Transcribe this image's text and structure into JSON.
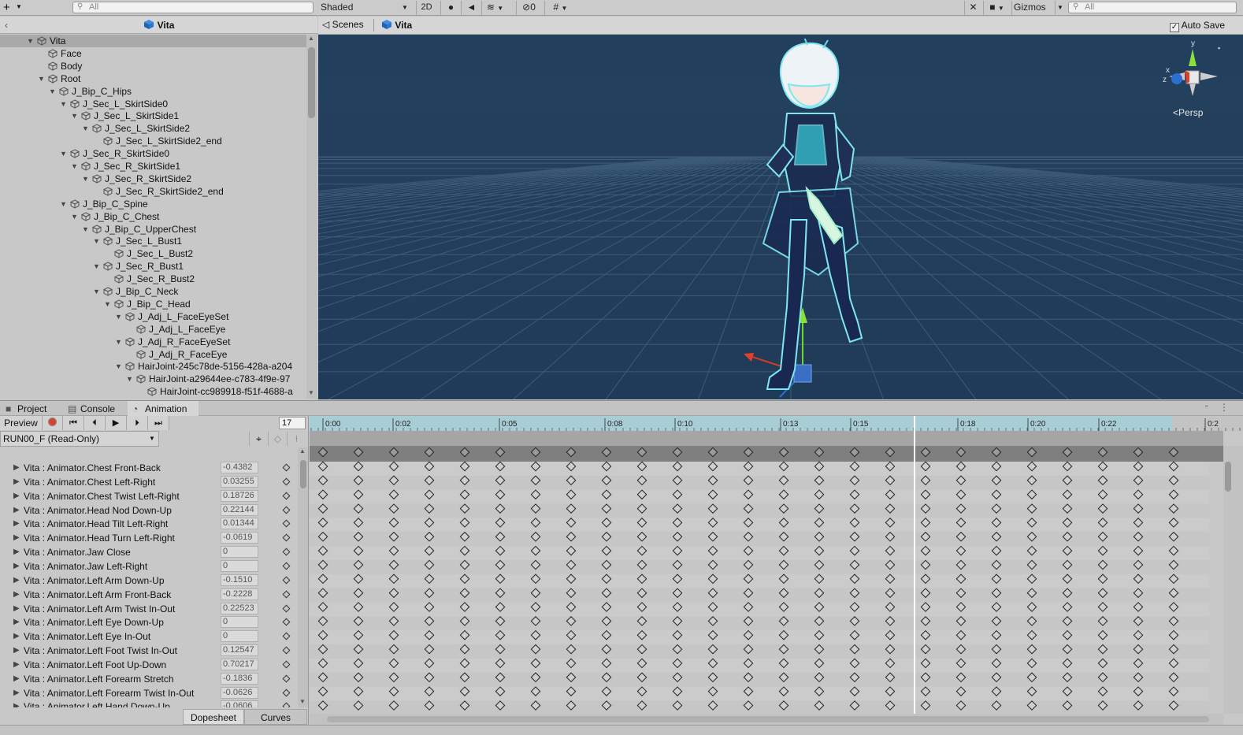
{
  "toolbar": {
    "create_label": "+",
    "hier_search_placeholder": "All",
    "shading_mode": "Shaded",
    "btn_2d": "2D",
    "hidden_count": "0",
    "gizmos_label": "Gizmos",
    "scene_search_placeholder": "All"
  },
  "hierarchy": {
    "title": "Vita",
    "items": [
      {
        "label": "Vita",
        "depth": 0,
        "expanded": true,
        "selected": true
      },
      {
        "label": "Face",
        "depth": 1,
        "expanded": null
      },
      {
        "label": "Body",
        "depth": 1,
        "expanded": null
      },
      {
        "label": "Root",
        "depth": 1,
        "expanded": true
      },
      {
        "label": "J_Bip_C_Hips",
        "depth": 2,
        "expanded": true
      },
      {
        "label": "J_Sec_L_SkirtSide0",
        "depth": 3,
        "expanded": true
      },
      {
        "label": "J_Sec_L_SkirtSide1",
        "depth": 4,
        "expanded": true
      },
      {
        "label": "J_Sec_L_SkirtSide2",
        "depth": 5,
        "expanded": true
      },
      {
        "label": "J_Sec_L_SkirtSide2_end",
        "depth": 6,
        "expanded": null
      },
      {
        "label": "J_Sec_R_SkirtSide0",
        "depth": 3,
        "expanded": true
      },
      {
        "label": "J_Sec_R_SkirtSide1",
        "depth": 4,
        "expanded": true
      },
      {
        "label": "J_Sec_R_SkirtSide2",
        "depth": 5,
        "expanded": true
      },
      {
        "label": "J_Sec_R_SkirtSide2_end",
        "depth": 6,
        "expanded": null
      },
      {
        "label": "J_Bip_C_Spine",
        "depth": 3,
        "expanded": true
      },
      {
        "label": "J_Bip_C_Chest",
        "depth": 4,
        "expanded": true
      },
      {
        "label": "J_Bip_C_UpperChest",
        "depth": 5,
        "expanded": true
      },
      {
        "label": "J_Sec_L_Bust1",
        "depth": 6,
        "expanded": true
      },
      {
        "label": "J_Sec_L_Bust2",
        "depth": 7,
        "expanded": null
      },
      {
        "label": "J_Sec_R_Bust1",
        "depth": 6,
        "expanded": true
      },
      {
        "label": "J_Sec_R_Bust2",
        "depth": 7,
        "expanded": null
      },
      {
        "label": "J_Bip_C_Neck",
        "depth": 6,
        "expanded": true
      },
      {
        "label": "J_Bip_C_Head",
        "depth": 7,
        "expanded": true
      },
      {
        "label": "J_Adj_L_FaceEyeSet",
        "depth": 8,
        "expanded": true
      },
      {
        "label": "J_Adj_L_FaceEye",
        "depth": 9,
        "expanded": null
      },
      {
        "label": "J_Adj_R_FaceEyeSet",
        "depth": 8,
        "expanded": true
      },
      {
        "label": "J_Adj_R_FaceEye",
        "depth": 9,
        "expanded": null
      },
      {
        "label": "HairJoint-245c78de-5156-428a-a204",
        "depth": 8,
        "expanded": true
      },
      {
        "label": "HairJoint-a29644ee-c783-4f9e-97",
        "depth": 9,
        "expanded": true
      },
      {
        "label": "HairJoint-cc989918-f51f-4688-a",
        "depth": 10,
        "expanded": null
      }
    ]
  },
  "scene": {
    "tab_scenes": "Scenes",
    "tab_object": "Vita",
    "auto_save_label": "Auto Save",
    "auto_save_checked": true,
    "projection_label": "Persp",
    "axis_x": "x",
    "axis_y": "y",
    "axis_z": "z"
  },
  "bottom_tabs": {
    "project": "Project",
    "console": "Console",
    "animation": "Animation"
  },
  "animation": {
    "preview_label": "Preview",
    "current_frame": "17",
    "clip_name": "RUN00_F (Read-Only)",
    "dopesheet_label": "Dopesheet",
    "curves_label": "Curves",
    "time_labels": [
      "0:00",
      "0:02",
      "0:05",
      "0:08",
      "0:10",
      "0:13",
      "0:15",
      "0:18",
      "0:20",
      "0:22",
      "0:2"
    ],
    "properties": [
      {
        "name": "Vita : Animator.Chest Front-Back",
        "value": "-0.4382"
      },
      {
        "name": "Vita : Animator.Chest Left-Right",
        "value": "0.03255"
      },
      {
        "name": "Vita : Animator.Chest Twist Left-Right",
        "value": "0.18726"
      },
      {
        "name": "Vita : Animator.Head Nod Down-Up",
        "value": "0.22144"
      },
      {
        "name": "Vita : Animator.Head Tilt Left-Right",
        "value": "0.01344"
      },
      {
        "name": "Vita : Animator.Head Turn Left-Right",
        "value": "-0.0619"
      },
      {
        "name": "Vita : Animator.Jaw Close",
        "value": "0"
      },
      {
        "name": "Vita : Animator.Jaw Left-Right",
        "value": "0"
      },
      {
        "name": "Vita : Animator.Left Arm Down-Up",
        "value": "-0.1510"
      },
      {
        "name": "Vita : Animator.Left Arm Front-Back",
        "value": "-0.2228"
      },
      {
        "name": "Vita : Animator.Left Arm Twist In-Out",
        "value": "0.22523"
      },
      {
        "name": "Vita : Animator.Left Eye Down-Up",
        "value": "0"
      },
      {
        "name": "Vita : Animator.Left Eye In-Out",
        "value": "0"
      },
      {
        "name": "Vita : Animator.Left Foot Twist In-Out",
        "value": "0.12547"
      },
      {
        "name": "Vita : Animator.Left Foot Up-Down",
        "value": "0.70217"
      },
      {
        "name": "Vita : Animator.Left Forearm Stretch",
        "value": "-0.1836"
      },
      {
        "name": "Vita : Animator.Left Forearm Twist In-Out",
        "value": "-0.0626"
      },
      {
        "name": "Vita : Animator.Left Hand Down-Up",
        "value": "-0.0606"
      }
    ]
  },
  "colors": {
    "viewport_bg": "#22405e",
    "grid_line": "#3d5c7a",
    "timeline_header": "#a9cdd4",
    "accent_blue": "#1b6fd6"
  }
}
